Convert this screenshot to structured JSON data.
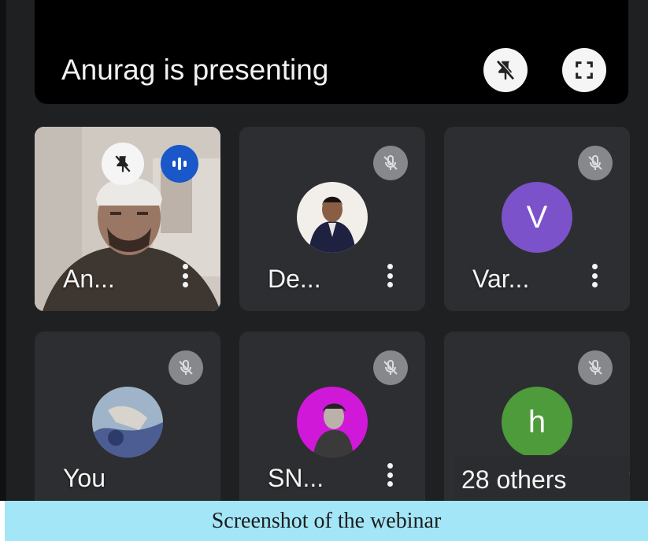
{
  "presentation": {
    "presenting_text": "Anurag is presenting"
  },
  "participants": [
    {
      "name": "An...",
      "avatar_letter": ""
    },
    {
      "name": "De...",
      "avatar_letter": ""
    },
    {
      "name": "Var...",
      "avatar_letter": "V"
    },
    {
      "name": "You",
      "avatar_letter": ""
    },
    {
      "name": "SN...",
      "avatar_letter": ""
    },
    {
      "name": "28 others",
      "avatar_letter": "h"
    }
  ],
  "caption": "Screenshot of the webinar",
  "colors": {
    "background": "#1f2022",
    "tile": "#2d2e31",
    "speaking_blue": "#1a57c8",
    "avatar_purple": "#7b52c9",
    "avatar_green": "#4d9b3a",
    "avatar_magenta": "#d018d8",
    "caption_bar": "#a3e6f7"
  },
  "icons": {
    "pin_off": "push-pin-off-icon",
    "fullscreen": "fullscreen-icon",
    "mic_off": "mic-off-icon",
    "speaking": "audio-level-icon",
    "more": "more-vert-icon"
  }
}
